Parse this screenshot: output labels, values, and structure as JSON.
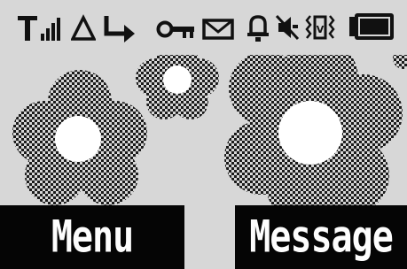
{
  "status_bar": {
    "icons": [
      "signal-antenna-icon",
      "signal-strength-bars-icon",
      "roaming-triangle-icon",
      "call-divert-arrow-icon",
      "key-lock-icon",
      "envelope-message-icon",
      "alarm-bell-icon",
      "silent-mode-icon",
      "vibrate-icon",
      "battery-full-icon"
    ]
  },
  "wallpaper": {
    "motif": "checkered-flowers",
    "colors": {
      "background": "#d7d7d7",
      "checker_dark": "#1b1b1b",
      "flower_center": "#ffffff"
    }
  },
  "softkeys": {
    "left_label": "Menu",
    "right_label": "Message",
    "background": "#050505",
    "text_color": "#fdfdfd"
  }
}
